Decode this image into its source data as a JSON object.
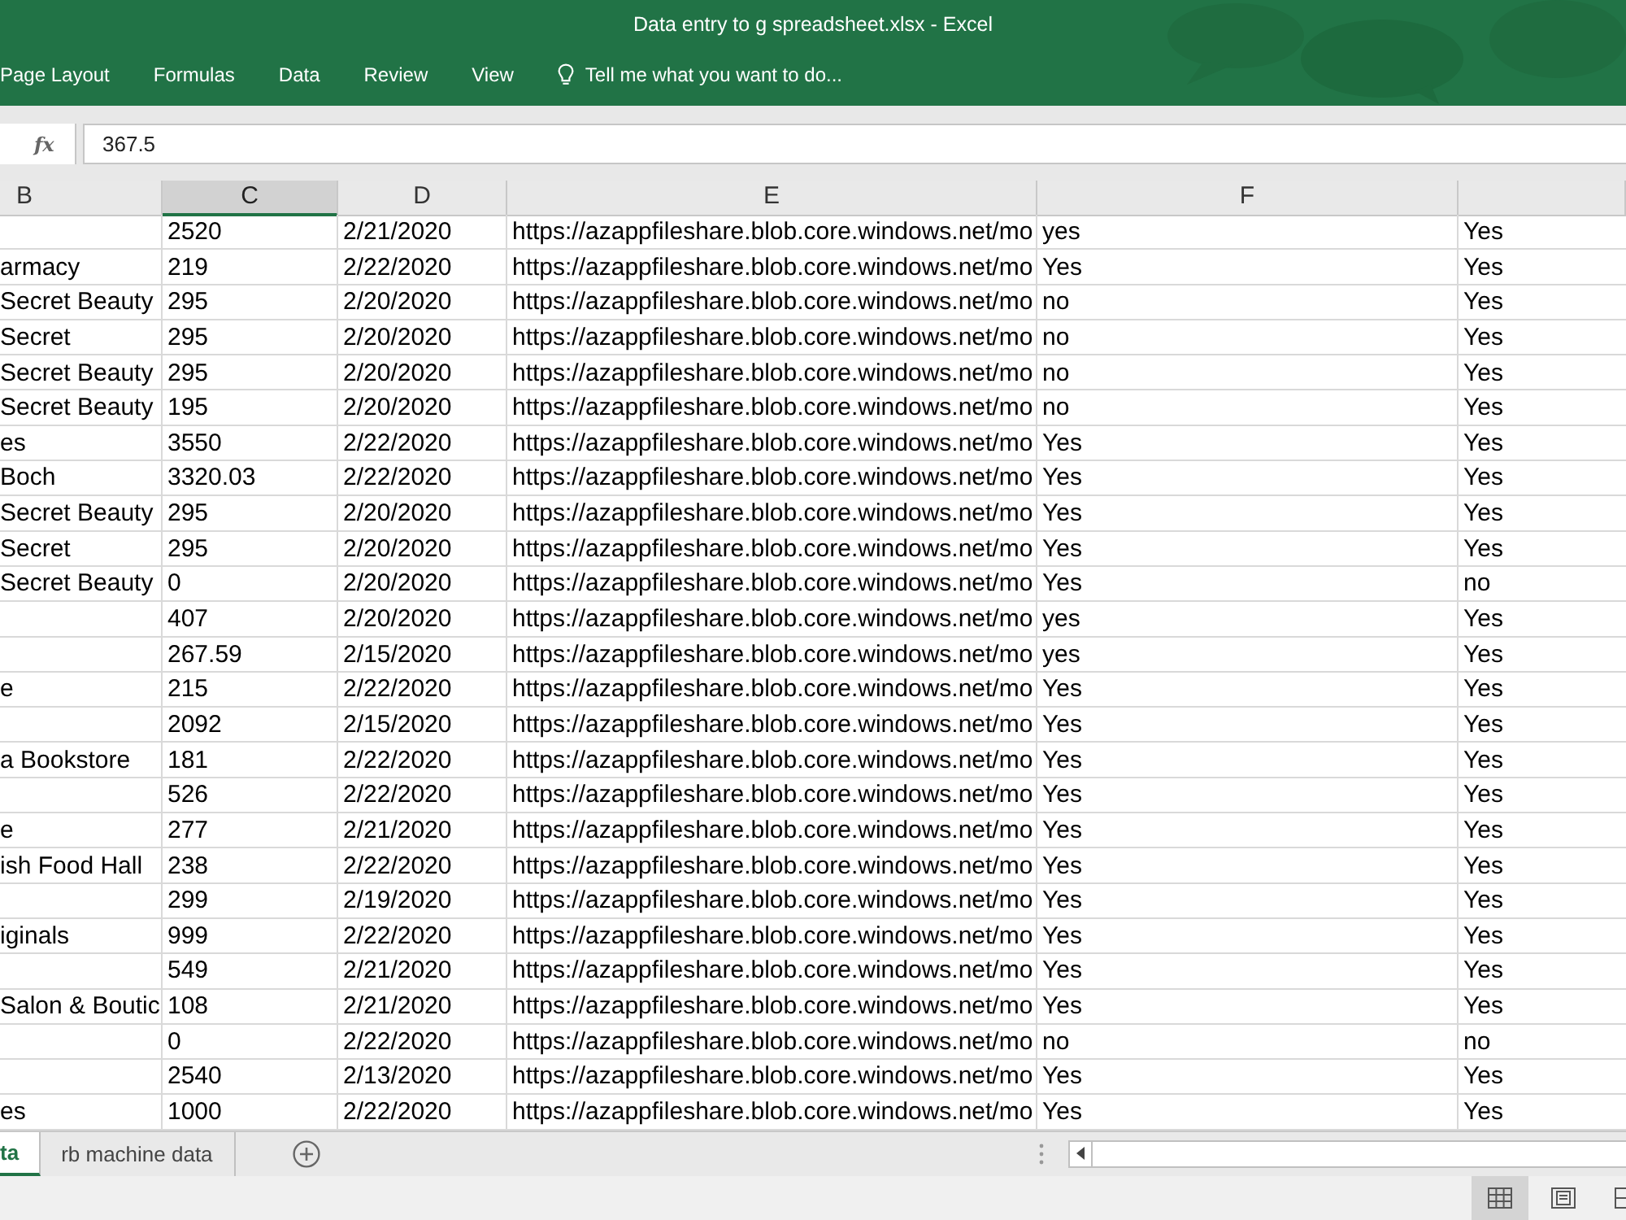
{
  "window": {
    "title": "Data entry to g spreadsheet.xlsx - Excel"
  },
  "ribbon_tabs": [
    {
      "label": "Page Layout",
      "selected": false
    },
    {
      "label": "Formulas",
      "selected": false
    },
    {
      "label": "Data",
      "selected": false
    },
    {
      "label": "Review",
      "selected": false
    },
    {
      "label": "View",
      "selected": false
    }
  ],
  "tell_me": {
    "placeholder": "Tell me what you want to do..."
  },
  "formula_bar": {
    "function_label": "fx",
    "value": "367.5"
  },
  "columns": [
    {
      "label": "B",
      "selected": false
    },
    {
      "label": "C",
      "selected": true
    },
    {
      "label": "D",
      "selected": false
    },
    {
      "label": "E",
      "selected": false
    },
    {
      "label": "F",
      "selected": false
    },
    {
      "selected": false
    }
  ],
  "rows": [
    {
      "C": "2520",
      "D": "2/21/2020",
      "E": "https://azappfileshare.blob.core.windows.net/mo",
      "F": "yes",
      "column_6": "Yes"
    },
    {
      "B": "armacy",
      "C": "219",
      "D": "2/22/2020",
      "E": "https://azappfileshare.blob.core.windows.net/mo",
      "F": "Yes",
      "column_6": "Yes"
    },
    {
      "B": "Secret Beauty",
      "C": "295",
      "D": "2/20/2020",
      "E": "https://azappfileshare.blob.core.windows.net/mo",
      "F": "no",
      "column_6": "Yes"
    },
    {
      "B": "Secret",
      "C": "295",
      "D": "2/20/2020",
      "E": "https://azappfileshare.blob.core.windows.net/mo",
      "F": "no",
      "column_6": "Yes"
    },
    {
      "B": "Secret Beauty",
      "C": "295",
      "D": "2/20/2020",
      "E": "https://azappfileshare.blob.core.windows.net/mo",
      "F": "no",
      "column_6": "Yes"
    },
    {
      "B": "Secret Beauty",
      "C": "195",
      "D": "2/20/2020",
      "E": "https://azappfileshare.blob.core.windows.net/mo",
      "F": "no",
      "column_6": "Yes"
    },
    {
      "B": "es",
      "C": "3550",
      "D": "2/22/2020",
      "E": "https://azappfileshare.blob.core.windows.net/mo",
      "F": "Yes",
      "column_6": "Yes"
    },
    {
      "B": "Boch",
      "C": "3320.03",
      "D": "2/22/2020",
      "E": "https://azappfileshare.blob.core.windows.net/mo",
      "F": "Yes",
      "column_6": "Yes"
    },
    {
      "B": "Secret Beauty",
      "C": "295",
      "D": "2/20/2020",
      "E": "https://azappfileshare.blob.core.windows.net/mo",
      "F": "Yes",
      "column_6": "Yes"
    },
    {
      "B": "Secret",
      "C": "295",
      "D": "2/20/2020",
      "E": "https://azappfileshare.blob.core.windows.net/mo",
      "F": "Yes",
      "column_6": "Yes"
    },
    {
      "B": "Secret Beauty",
      "C": "0",
      "D": "2/20/2020",
      "E": "https://azappfileshare.blob.core.windows.net/mo",
      "F": "Yes",
      "column_6": "no"
    },
    {
      "C": "407",
      "D": "2/20/2020",
      "E": "https://azappfileshare.blob.core.windows.net/mo",
      "F": "yes",
      "column_6": "Yes"
    },
    {
      "C": "267.59",
      "D": "2/15/2020",
      "E": "https://azappfileshare.blob.core.windows.net/mo",
      "F": "yes",
      "column_6": "Yes"
    },
    {
      "B": "e",
      "C": "215",
      "D": "2/22/2020",
      "E": "https://azappfileshare.blob.core.windows.net/mo",
      "F": "Yes",
      "column_6": "Yes"
    },
    {
      "C": "2092",
      "D": "2/15/2020",
      "E": "https://azappfileshare.blob.core.windows.net/mo",
      "F": "Yes",
      "column_6": "Yes"
    },
    {
      "B": "a Bookstore",
      "C": "181",
      "D": "2/22/2020",
      "E": "https://azappfileshare.blob.core.windows.net/mo",
      "F": "Yes",
      "column_6": "Yes"
    },
    {
      "C": "526",
      "D": "2/22/2020",
      "E": "https://azappfileshare.blob.core.windows.net/mo",
      "F": "Yes",
      "column_6": "Yes"
    },
    {
      "B": "e",
      "C": "277",
      "D": "2/21/2020",
      "E": "https://azappfileshare.blob.core.windows.net/mo",
      "F": "Yes",
      "column_6": "Yes"
    },
    {
      "B": "ish Food Hall",
      "C": "238",
      "D": "2/22/2020",
      "E": "https://azappfileshare.blob.core.windows.net/mo",
      "F": "Yes",
      "column_6": "Yes"
    },
    {
      "C": "299",
      "D": "2/19/2020",
      "E": "https://azappfileshare.blob.core.windows.net/mo",
      "F": "Yes",
      "column_6": "Yes"
    },
    {
      "B": "iginals",
      "C": "999",
      "D": "2/22/2020",
      "E": "https://azappfileshare.blob.core.windows.net/mo",
      "F": "Yes",
      "column_6": "Yes"
    },
    {
      "C": "549",
      "D": "2/21/2020",
      "E": "https://azappfileshare.blob.core.windows.net/mo",
      "F": "Yes",
      "column_6": "Yes"
    },
    {
      "B": "Salon & Boutic",
      "C": "108",
      "D": "2/21/2020",
      "E": "https://azappfileshare.blob.core.windows.net/mo",
      "F": "Yes",
      "column_6": "Yes"
    },
    {
      "C": "0",
      "D": "2/22/2020",
      "E": "https://azappfileshare.blob.core.windows.net/mo",
      "F": "no",
      "column_6": "no"
    },
    {
      "C": "2540",
      "D": "2/13/2020",
      "E": "https://azappfileshare.blob.core.windows.net/mo",
      "F": "Yes",
      "column_6": "Yes"
    },
    {
      "B": "es",
      "C": "1000",
      "D": "2/22/2020",
      "E": "https://azappfileshare.blob.core.windows.net/mo",
      "F": "Yes",
      "column_6": "Yes"
    }
  ],
  "sheet_tabs": [
    {
      "label": "ta",
      "selected": true
    },
    {
      "label": "rb machine data",
      "selected": false
    }
  ],
  "status_bar": {
    "views": [
      {
        "kind": "normal",
        "selected": true
      },
      {
        "kind": "page_layout",
        "selected": false
      },
      {
        "kind": "page_break",
        "selected": false
      }
    ]
  }
}
